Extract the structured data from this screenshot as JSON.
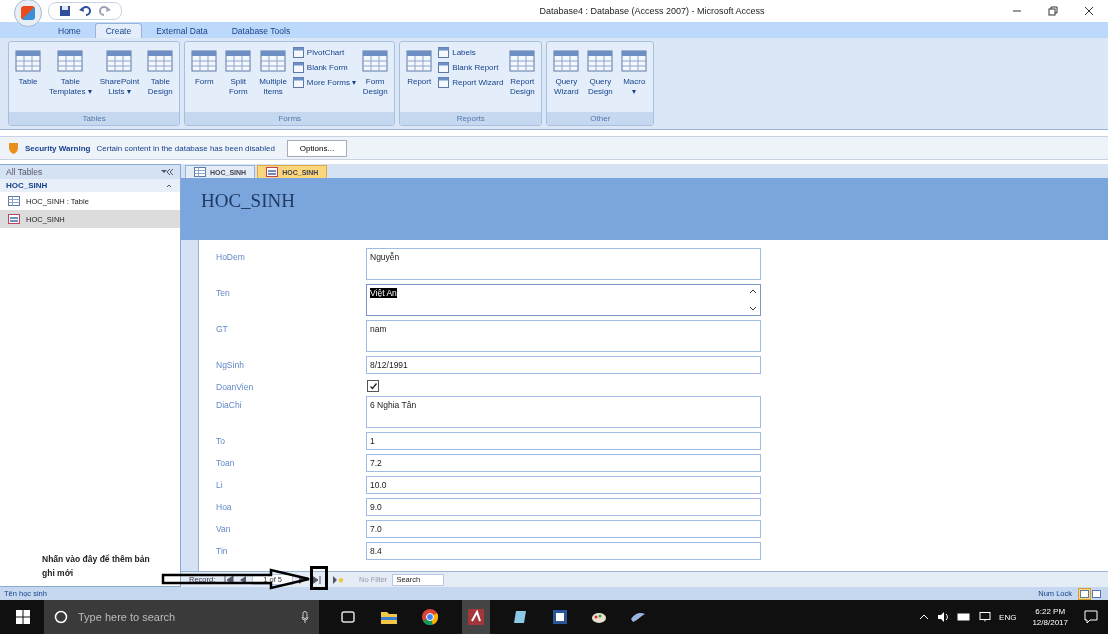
{
  "window": {
    "title": "Database4 : Database (Access 2007) - Microsoft Access"
  },
  "ribbon_tabs": [
    {
      "label": "Home",
      "selected": false
    },
    {
      "label": "Create",
      "selected": true
    },
    {
      "label": "External Data",
      "selected": false
    },
    {
      "label": "Database Tools",
      "selected": false
    }
  ],
  "ribbon_groups": [
    {
      "name": "Tables",
      "items": [
        {
          "kind": "large",
          "label": "Table"
        },
        {
          "kind": "large",
          "label": "Table\nTemplates ▾"
        },
        {
          "kind": "large",
          "label": "SharePoint\nLists ▾"
        },
        {
          "kind": "large",
          "label": "Table\nDesign"
        }
      ]
    },
    {
      "name": "Forms",
      "items": [
        {
          "kind": "large",
          "label": "Form"
        },
        {
          "kind": "large",
          "label": "Split\nForm"
        },
        {
          "kind": "large",
          "label": "Multiple\nItems"
        },
        {
          "kind": "stack",
          "items": [
            "PivotChart",
            "Blank Form",
            "More Forms ▾"
          ]
        },
        {
          "kind": "large",
          "label": "Form\nDesign"
        }
      ]
    },
    {
      "name": "Reports",
      "items": [
        {
          "kind": "large",
          "label": "Report"
        },
        {
          "kind": "stack",
          "items": [
            "Labels",
            "Blank Report",
            "Report Wizard"
          ]
        },
        {
          "kind": "large",
          "label": "Report\nDesign"
        }
      ]
    },
    {
      "name": "Other",
      "items": [
        {
          "kind": "large",
          "label": "Query\nWizard"
        },
        {
          "kind": "large",
          "label": "Query\nDesign"
        },
        {
          "kind": "large",
          "label": "Macro\n▾"
        }
      ]
    }
  ],
  "security_bar": {
    "title": "Security Warning",
    "message": "Certain content in the database has been disabled",
    "button": "Options..."
  },
  "navigation_pane": {
    "header": "All Tables",
    "group": "HOC_SINH",
    "items": [
      {
        "label": "HOC_SINH : Table",
        "kind": "table",
        "selected": false
      },
      {
        "label": "HOC_SINH",
        "kind": "form",
        "selected": true
      }
    ]
  },
  "document_tabs": [
    {
      "label": "HOC_SINH",
      "kind": "table",
      "selected": false
    },
    {
      "label": "HOC_SINH",
      "kind": "form",
      "selected": true
    }
  ],
  "form": {
    "title": "HOC_SINH",
    "fields": [
      {
        "label": "HoDem",
        "kind": "memo",
        "value": "Nguyễn",
        "focused": false
      },
      {
        "label": "Ten",
        "kind": "memo",
        "value": "Việt An",
        "focused": true
      },
      {
        "label": "GT",
        "kind": "memo",
        "value": "nam",
        "focused": false
      },
      {
        "label": "NgSinh",
        "kind": "text",
        "value": "8/12/1991",
        "focused": false
      },
      {
        "label": "DoanVien",
        "kind": "checkbox",
        "checked": true
      },
      {
        "label": "DiaChi",
        "kind": "memo",
        "value": "6 Nghia Tân",
        "focused": false
      },
      {
        "label": "To",
        "kind": "text",
        "value": "1",
        "focused": false
      },
      {
        "label": "Toan",
        "kind": "text",
        "value": "7.2",
        "focused": false
      },
      {
        "label": "Li",
        "kind": "text",
        "value": "10.0",
        "focused": false
      },
      {
        "label": "Hoa",
        "kind": "text",
        "value": "9.0",
        "focused": false
      },
      {
        "label": "Van",
        "kind": "text",
        "value": "7.0",
        "focused": false
      },
      {
        "label": "Tin",
        "kind": "text",
        "value": "8.4",
        "focused": false
      }
    ]
  },
  "record_navigator": {
    "label": "Record:",
    "position": "1 of 5",
    "filter": "No Filter",
    "search_placeholder": "Search"
  },
  "annotation": {
    "text": "Nhấn vào đây để thêm bản ghi mới"
  },
  "status_bar": {
    "left": "Tên học sinh",
    "right": "Num Lock"
  },
  "taskbar": {
    "search_placeholder": "Type here to search",
    "language": "ENG",
    "time": "6:22 PM",
    "date": "12/8/2017"
  }
}
